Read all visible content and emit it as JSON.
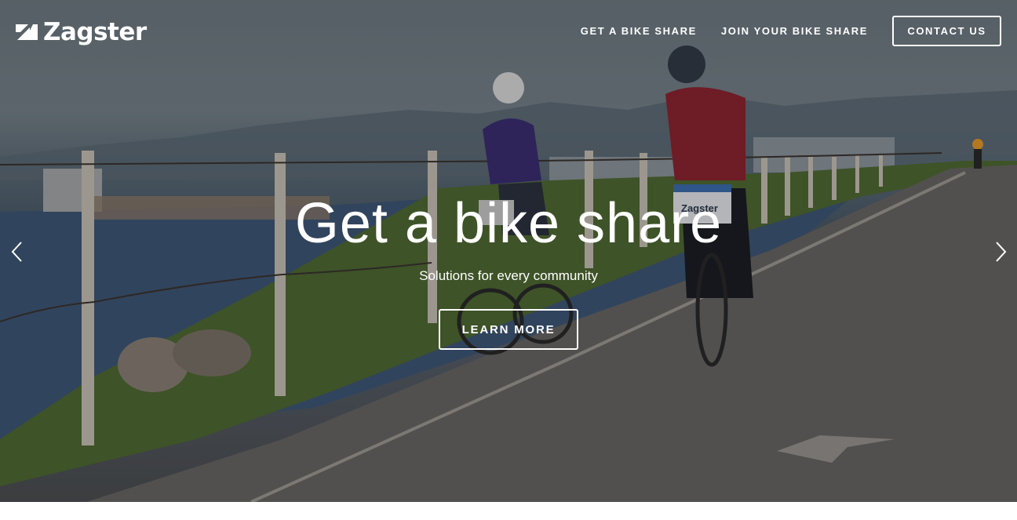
{
  "brand": {
    "name": "Zagster",
    "icon": "zagster-logo-mark"
  },
  "nav": {
    "items": [
      {
        "label": "GET A BIKE SHARE"
      },
      {
        "label": "JOIN YOUR BIKE SHARE"
      }
    ],
    "contact_label": "CONTACT US"
  },
  "hero": {
    "headline": "Get a bike share",
    "subheadline": "Solutions for every community",
    "cta_label": "LEARN MORE",
    "prev_icon": "chevron-left-icon",
    "next_icon": "chevron-right-icon",
    "basket_sign": "Zagster"
  }
}
